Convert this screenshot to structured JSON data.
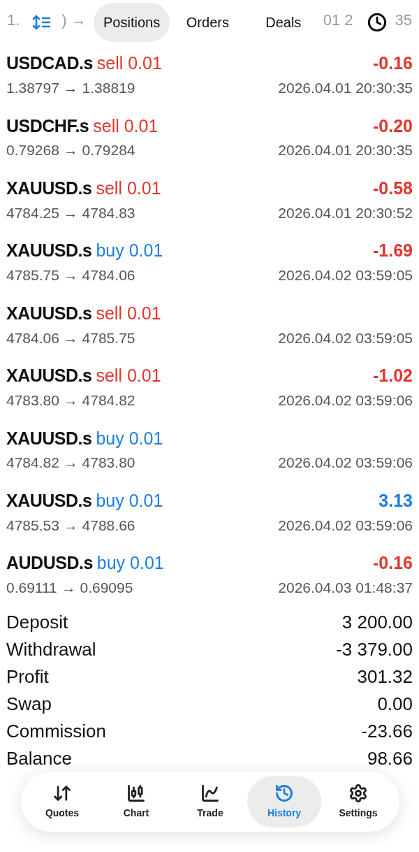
{
  "peek": [
    "1.",
    ") →",
    "01 2",
    "35"
  ],
  "tabs": [
    {
      "label": "Positions",
      "selected": true
    },
    {
      "label": "Orders",
      "selected": false
    },
    {
      "label": "Deals",
      "selected": false
    }
  ],
  "deals": [
    {
      "symbol": "USDCAD.s",
      "side": {
        "text": "sell 0.01",
        "color": "#e0362c"
      },
      "prices": "1.38797 → 1.38819",
      "time": "2026.04.01 20:30:35",
      "profit": {
        "text": "-0.16",
        "color": "#e0362c"
      }
    },
    {
      "symbol": "USDCHF.s",
      "side": {
        "text": "sell 0.01",
        "color": "#e0362c"
      },
      "prices": "0.79268 → 0.79284",
      "time": "2026.04.01 20:30:35",
      "profit": {
        "text": "-0.20",
        "color": "#e0362c"
      }
    },
    {
      "symbol": "XAUUSD.s",
      "side": {
        "text": "sell 0.01",
        "color": "#e0362c"
      },
      "prices": "4784.25 → 4784.83",
      "time": "2026.04.01 20:30:52",
      "profit": {
        "text": "-0.58",
        "color": "#e0362c"
      }
    },
    {
      "symbol": "XAUUSD.s",
      "side": {
        "text": "buy 0.01",
        "color": "#1c7fe0"
      },
      "prices": "4785.75 → 4784.06",
      "time": "2026.04.02 03:59:05",
      "profit": {
        "text": "-1.69",
        "color": "#e0362c"
      }
    },
    {
      "symbol": "XAUUSD.s",
      "side": {
        "text": "sell 0.01",
        "color": "#e0362c"
      },
      "prices": "4784.06 → 4785.75",
      "time": "2026.04.02 03:59:05"
    },
    {
      "symbol": "XAUUSD.s",
      "side": {
        "text": "sell 0.01",
        "color": "#e0362c"
      },
      "prices": "4783.80 → 4784.82",
      "time": "2026.04.02 03:59:06",
      "profit": {
        "text": "-1.02",
        "color": "#e0362c"
      }
    },
    {
      "symbol": "XAUUSD.s",
      "side": {
        "text": "buy 0.01",
        "color": "#1c7fe0"
      },
      "prices": "4784.82 → 4783.80",
      "time": "2026.04.02 03:59:06"
    },
    {
      "symbol": "XAUUSD.s",
      "side": {
        "text": "buy 0.01",
        "color": "#1c7fe0"
      },
      "prices": "4785.53 → 4788.66",
      "time": "2026.04.02 03:59:06",
      "profit": {
        "text": "3.13",
        "color": "#1c7fe0"
      }
    },
    {
      "symbol": "AUDUSD.s",
      "side": {
        "text": "buy 0.01",
        "color": "#1c7fe0"
      },
      "prices": "0.69111 → 0.69095",
      "time": "2026.04.03 01:48:37",
      "profit": {
        "text": "-0.16",
        "color": "#e0362c"
      }
    }
  ],
  "summary": [
    {
      "label": "Deposit",
      "value": "3 200.00"
    },
    {
      "label": "Withdrawal",
      "value": "-3 379.00"
    },
    {
      "label": "Profit",
      "value": "301.32"
    },
    {
      "label": "Swap",
      "value": "0.00"
    },
    {
      "label": "Commission",
      "value": "-23.66"
    },
    {
      "label": "Balance",
      "value": "98.66"
    }
  ],
  "nav": [
    {
      "label": "Quotes",
      "selected": false
    },
    {
      "label": "Chart",
      "selected": false
    },
    {
      "label": "Trade",
      "selected": false
    },
    {
      "label": "History",
      "selected": true
    },
    {
      "label": "Settings",
      "selected": false
    }
  ]
}
